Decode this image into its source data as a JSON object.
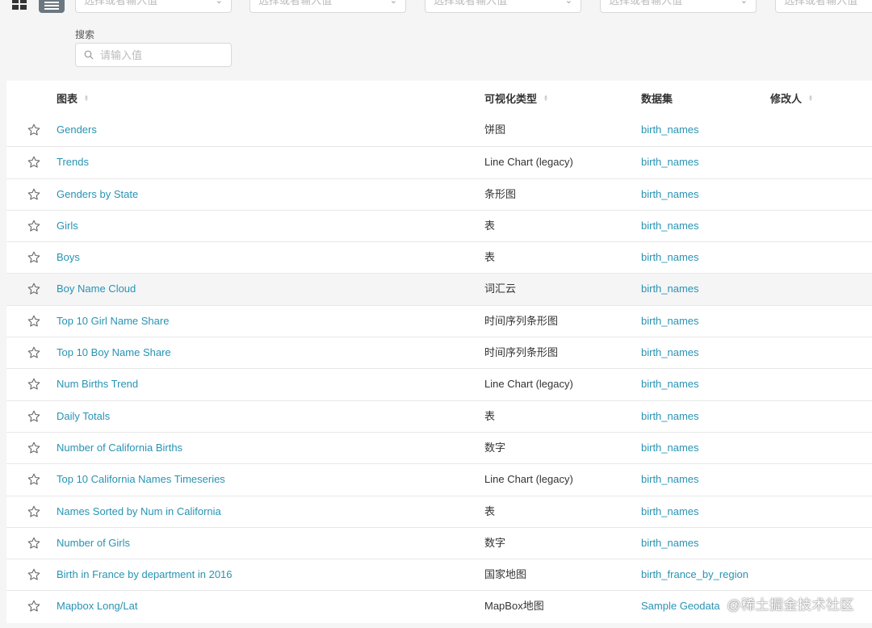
{
  "filters": {
    "placeholders": [
      "选择或者输入值",
      "选择或者输入值",
      "选择或者输入值",
      "选择或者输入值",
      "选择或者输入值"
    ]
  },
  "search": {
    "label": "搜索",
    "placeholder": "请输入值"
  },
  "table": {
    "headers": {
      "name": "图表",
      "viz_type": "可视化类型",
      "dataset": "数据集",
      "modified_by": "修改人"
    },
    "rows": [
      {
        "name": "Genders",
        "viz_type": "饼图",
        "dataset": "birth_names"
      },
      {
        "name": "Trends",
        "viz_type": "Line Chart (legacy)",
        "dataset": "birth_names"
      },
      {
        "name": "Genders by State",
        "viz_type": "条形图",
        "dataset": "birth_names"
      },
      {
        "name": "Girls",
        "viz_type": "表",
        "dataset": "birth_names"
      },
      {
        "name": "Boys",
        "viz_type": "表",
        "dataset": "birth_names"
      },
      {
        "name": "Boy Name Cloud",
        "viz_type": "词汇云",
        "dataset": "birth_names"
      },
      {
        "name": "Top 10 Girl Name Share",
        "viz_type": "时间序列条形图",
        "dataset": "birth_names"
      },
      {
        "name": "Top 10 Boy Name Share",
        "viz_type": "时间序列条形图",
        "dataset": "birth_names"
      },
      {
        "name": "Num Births Trend",
        "viz_type": "Line Chart (legacy)",
        "dataset": "birth_names"
      },
      {
        "name": "Daily Totals",
        "viz_type": "表",
        "dataset": "birth_names"
      },
      {
        "name": "Number of California Births",
        "viz_type": "数字",
        "dataset": "birth_names"
      },
      {
        "name": "Top 10 California Names Timeseries",
        "viz_type": "Line Chart (legacy)",
        "dataset": "birth_names"
      },
      {
        "name": "Names Sorted by Num in California",
        "viz_type": "表",
        "dataset": "birth_names"
      },
      {
        "name": "Number of Girls",
        "viz_type": "数字",
        "dataset": "birth_names"
      },
      {
        "name": "Birth in France by department in 2016",
        "viz_type": "国家地图",
        "dataset": "birth_france_by_region"
      },
      {
        "name": "Mapbox Long/Lat",
        "viz_type": "MapBox地图",
        "dataset": "Sample Geodata"
      }
    ]
  },
  "watermark": "@稀土掘金技术社区",
  "colors": {
    "link": "#2893b3",
    "active_toggle": "#6b7780"
  }
}
